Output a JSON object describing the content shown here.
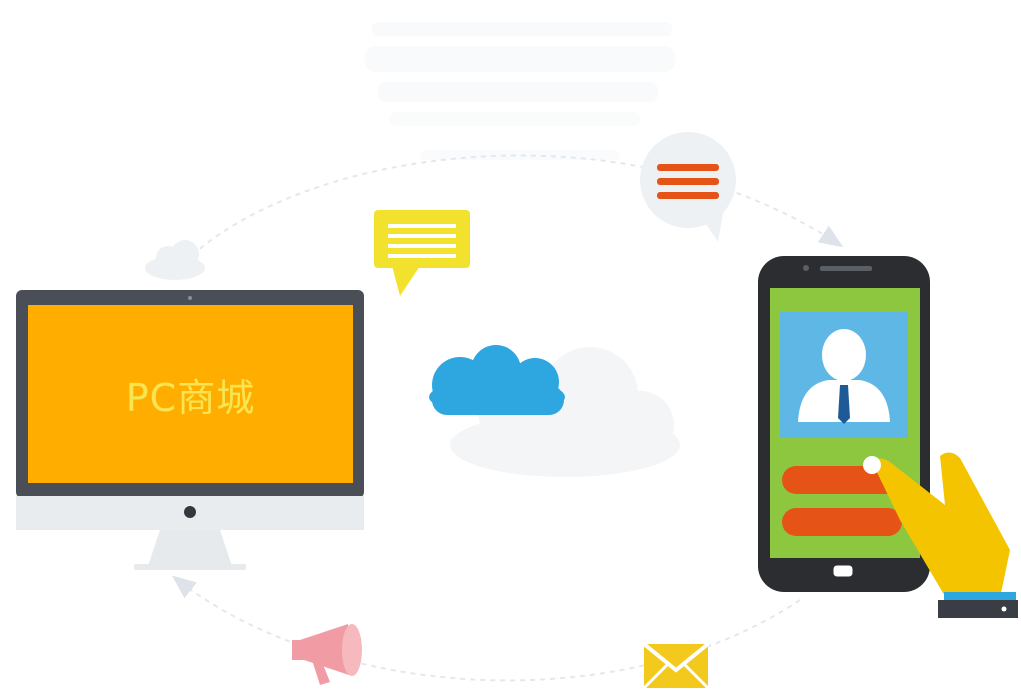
{
  "monitor": {
    "screen_label": "PC商城",
    "screen_color": "#ffae00",
    "bezel_color": "#4a4f57"
  },
  "phone": {
    "screen_color": "#8dc63f",
    "body_color": "#2b2d31",
    "avatar_panel_color": "#5fb7e5",
    "button_color": "#e65316"
  },
  "icons": {
    "chat_bubble_yellow": "message-bubble-icon",
    "chat_bubble_menu": "menu-bubble-icon",
    "cloud_center": "cloud-icon",
    "megaphone": "megaphone-icon",
    "envelope": "envelope-icon",
    "hand": "hand-pointer-icon"
  },
  "colors": {
    "cloud_blue": "#2ea7e0",
    "bubble_yellow": "#f2e22e",
    "menu_orange": "#e65316",
    "hand_yellow": "#f5c400",
    "megaphone_pink": "#f19ca5",
    "envelope_yellow": "#f4c91d"
  }
}
